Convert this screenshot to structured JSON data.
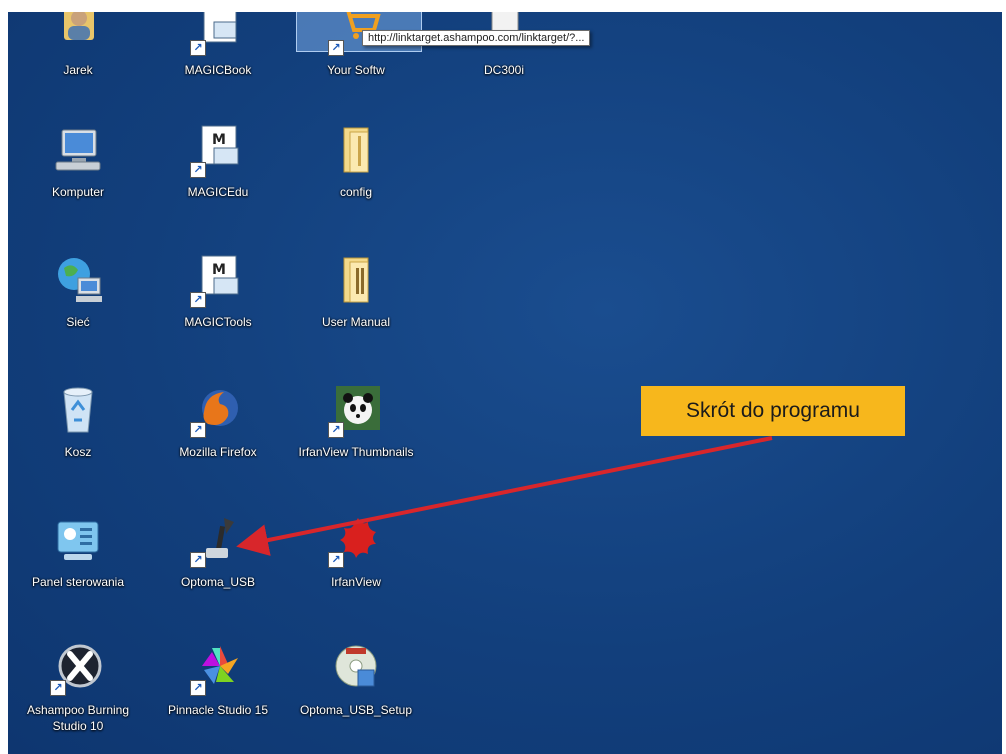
{
  "desktop": {
    "icons": [
      {
        "label": "Jarek"
      },
      {
        "label": "MAGICBook"
      },
      {
        "label": "Your Softw"
      },
      {
        "label": "DC300i"
      },
      {
        "label": "Komputer"
      },
      {
        "label": "MAGICEdu"
      },
      {
        "label": "config"
      },
      {
        "label": "Sieć"
      },
      {
        "label": "MAGICTools"
      },
      {
        "label": "User Manual"
      },
      {
        "label": "Kosz"
      },
      {
        "label": "Mozilla Firefox"
      },
      {
        "label": "IrfanView Thumbnails"
      },
      {
        "label": "Panel sterowania"
      },
      {
        "label": "Optoma_USB"
      },
      {
        "label": "IrfanView"
      },
      {
        "label": "Ashampoo Burning Studio 10"
      },
      {
        "label": "Pinnacle Studio 15"
      },
      {
        "label": "Optoma_USB_Setup"
      }
    ]
  },
  "tooltip": {
    "text": "http://linktarget.ashampoo.com/linktarget/?..."
  },
  "callout": {
    "text": "Skrót do programu"
  },
  "colors": {
    "desktop_bg": "#123f7c",
    "callout_bg": "#f7b71c",
    "arrow": "#d8262b"
  }
}
